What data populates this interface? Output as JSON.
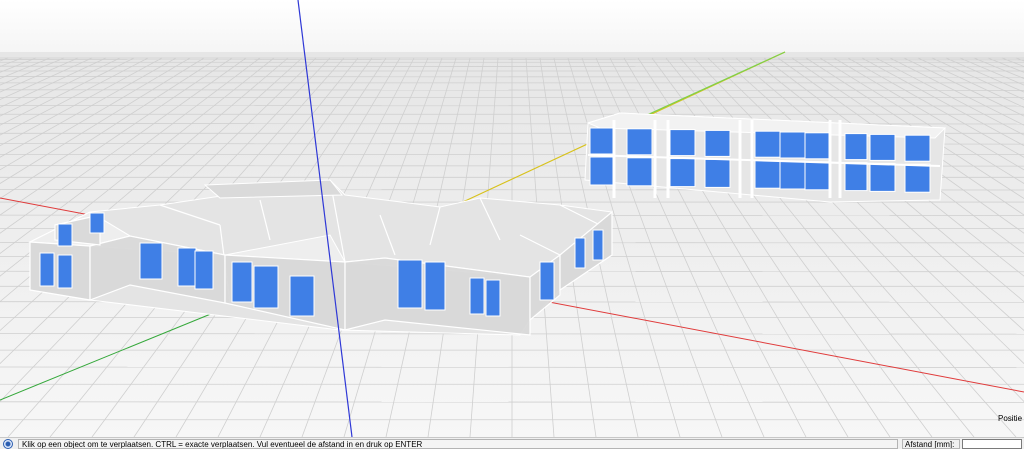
{
  "viewport": {
    "position_label": "Positie"
  },
  "statusbar": {
    "message": "Klik op een object om te verplaatsen. CTRL = exacte verplaatsen. Vul eventueel de afstand in en druk op ENTER",
    "distance_label": "Afstand [mm]:",
    "distance_value": ""
  },
  "colors": {
    "x_axis": "#e03b3b",
    "y_axis": "#34a83a",
    "z_axis": "#2f38d6",
    "grid": "#cfcfcf",
    "window": "#3f7fe6",
    "module_wall": "#d8d8d8"
  }
}
